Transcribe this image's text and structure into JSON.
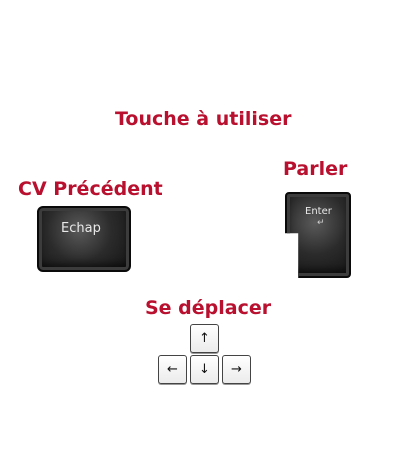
{
  "title": "Touche à utiliser",
  "sections": {
    "previous_cv": {
      "label": "CV Précédent",
      "key_label": "Echap"
    },
    "speak": {
      "label": "Parler",
      "key_label": "Enter",
      "key_symbol": "↵"
    },
    "move": {
      "label": "Se déplacer",
      "keys": {
        "up": "↑",
        "left": "←",
        "down": "↓",
        "right": "→"
      }
    }
  },
  "colors": {
    "heading": "#b8102e",
    "key_dark": "#2b2b2b",
    "key_light": "#ffffff"
  },
  "icons": {
    "up": "arrow-up-icon",
    "left": "arrow-left-icon",
    "down": "arrow-down-icon",
    "right": "arrow-right-icon"
  }
}
